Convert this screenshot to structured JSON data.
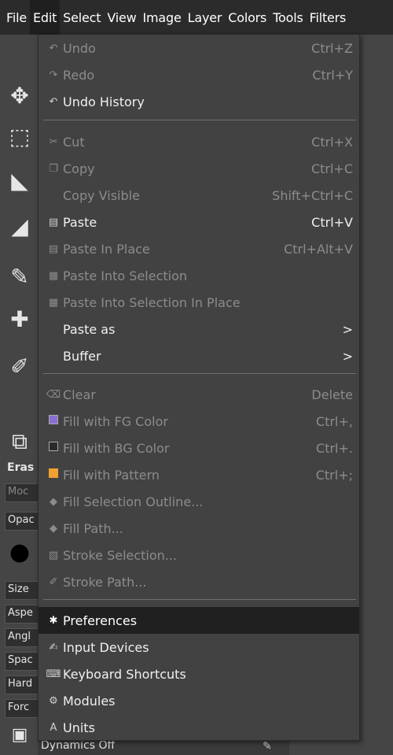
{
  "menubar": {
    "items": [
      "File",
      "Edit",
      "Select",
      "View",
      "Image",
      "Layer",
      "Colors",
      "Tools",
      "Filters"
    ],
    "active": "Edit"
  },
  "edit_menu": {
    "undo": {
      "label": "Undo",
      "shortcut": "Ctrl+Z"
    },
    "redo": {
      "label": "Redo",
      "shortcut": "Ctrl+Y"
    },
    "undo_history": {
      "label": "Undo History"
    },
    "cut": {
      "label": "Cut",
      "shortcut": "Ctrl+X"
    },
    "copy": {
      "label": "Copy",
      "shortcut": "Ctrl+C"
    },
    "copy_visible": {
      "label": "Copy Visible",
      "shortcut": "Shift+Ctrl+C"
    },
    "paste": {
      "label": "Paste",
      "shortcut": "Ctrl+V"
    },
    "paste_in_place": {
      "label": "Paste In Place",
      "shortcut": "Ctrl+Alt+V"
    },
    "paste_into_selection": {
      "label": "Paste Into Selection"
    },
    "paste_into_selection_in_place": {
      "label": "Paste Into Selection In Place"
    },
    "paste_as": {
      "label": "Paste as",
      "submenu_arrow": ">"
    },
    "buffer": {
      "label": "Buffer",
      "submenu_arrow": ">"
    },
    "clear": {
      "label": "Clear",
      "shortcut": "Delete"
    },
    "fill_fg": {
      "label": "Fill with FG Color",
      "shortcut": "Ctrl+,",
      "swatch_color": "#8a6fd1"
    },
    "fill_bg": {
      "label": "Fill with BG Color",
      "shortcut": "Ctrl+.",
      "swatch_color": "#2a2a2a"
    },
    "fill_pattern": {
      "label": "Fill with Pattern",
      "shortcut": "Ctrl+;",
      "swatch_color": "#f0a030"
    },
    "fill_selection_outline": {
      "label": "Fill Selection Outline..."
    },
    "fill_path": {
      "label": "Fill Path..."
    },
    "stroke_selection": {
      "label": "Stroke Selection..."
    },
    "stroke_path": {
      "label": "Stroke Path..."
    },
    "preferences": {
      "label": "Preferences"
    },
    "input_devices": {
      "label": "Input Devices"
    },
    "keyboard_shortcuts": {
      "label": "Keyboard Shortcuts"
    },
    "modules": {
      "label": "Modules"
    },
    "units": {
      "label": "Units"
    }
  },
  "tool_options": {
    "title": "Eras",
    "mode": "Moc",
    "opacity": "Opac",
    "size": "Size",
    "aspect": "Aspe",
    "angle": "Angl",
    "spacing": "Spac",
    "hardness": "Hard",
    "force": "Forc",
    "dynamics": "Dynamics Off"
  },
  "colors": {
    "menubar_bg": "#2b2b2b",
    "menu_bg": "#424242",
    "highlight_bg": "#202020"
  }
}
